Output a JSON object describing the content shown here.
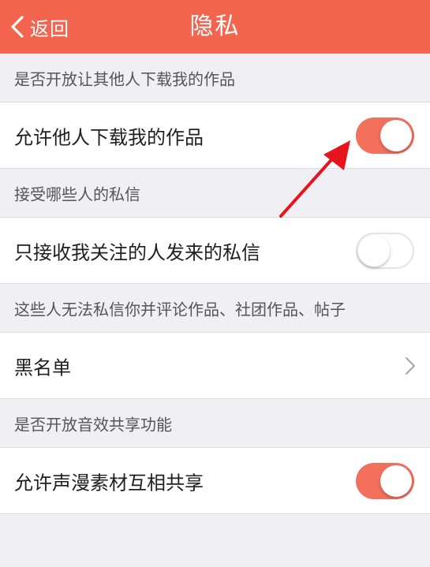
{
  "colors": {
    "accent": "#f3654f",
    "background": "#efeff4",
    "annotation_arrow": "#e8141b"
  },
  "nav": {
    "back_label": "返回",
    "back_icon": "chevron-left-icon",
    "title": "隐私"
  },
  "sections": [
    {
      "header": "是否开放让其他人下载我的作品",
      "row_label": "允许他人下载我的作品",
      "control": "toggle",
      "enabled": true
    },
    {
      "header": "接受哪些人的私信",
      "row_label": "只接收我关注的人发来的私信",
      "control": "toggle",
      "enabled": false
    },
    {
      "header": "这些人无法私信你并评论作品、社团作品、帖子",
      "row_label": "黑名单",
      "control": "disclosure",
      "icon": "chevron-right-icon"
    },
    {
      "header": "是否开放音效共享功能",
      "row_label": "允许声漫素材互相共享",
      "control": "toggle",
      "enabled": true
    }
  ],
  "annotation": {
    "type": "arrow",
    "points_to": "允许他人下载我的作品 toggle"
  }
}
